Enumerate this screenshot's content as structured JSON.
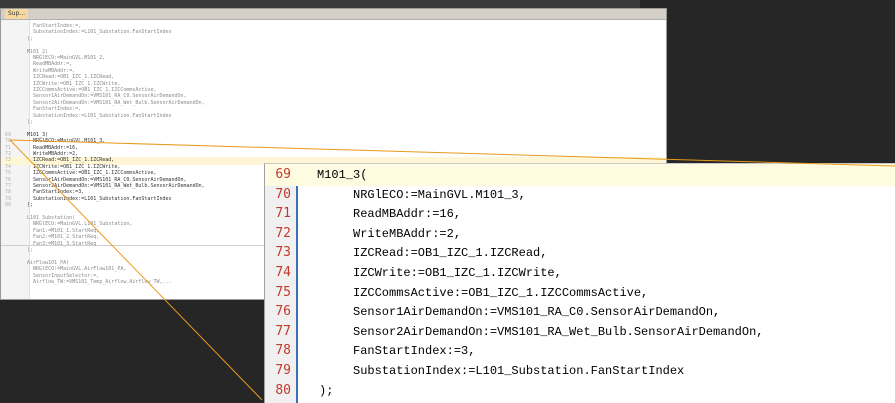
{
  "editor": {
    "tab_label": "Sup...",
    "small_lines": [
      {
        "n": "",
        "t": "    FanStartIndex:=,"
      },
      {
        "n": "",
        "t": "    SubstationIndex:=L101_Substation.FanStartIndex"
      },
      {
        "n": "",
        "t": "  );"
      },
      {
        "n": "",
        "t": ""
      },
      {
        "n": "",
        "t": "  M101_2("
      },
      {
        "n": "",
        "t": "    NRGlECO:=MainGVL.M101_2,"
      },
      {
        "n": "",
        "t": "    ReadMBAddr:=,"
      },
      {
        "n": "",
        "t": "    WriteMBAddr:=,"
      },
      {
        "n": "",
        "t": "    IZCRead:=OB1_IZC_1.IZCRead,"
      },
      {
        "n": "",
        "t": "    IZCWrite:=OB1_IZC_1.IZCWrite,"
      },
      {
        "n": "",
        "t": "    IZCCommsActive:=OB1_IZC_1.IZCCommsActive,"
      },
      {
        "n": "",
        "t": "    Sensor1AirDemandOn:=VMS101_RA_C0.SensorAirDemandOn,"
      },
      {
        "n": "",
        "t": "    Sensor2AirDemandOn:=VMS101_RA_Wet_Bulb.SensorAirDemandOn,"
      },
      {
        "n": "",
        "t": "    FanStartIndex:=,"
      },
      {
        "n": "",
        "t": "    SubstationIndex:=L101_Substation.FanStartIndex"
      },
      {
        "n": "",
        "t": "  );"
      },
      {
        "n": "",
        "t": ""
      },
      {
        "n": "69",
        "t": "  M101_3("
      },
      {
        "n": "70",
        "t": "    NRGlECO:=MainGVL.M101_3,"
      },
      {
        "n": "71",
        "t": "    ReadMBAddr:=16,"
      },
      {
        "n": "72",
        "t": "    WriteMBAddr:=2,"
      },
      {
        "n": "73",
        "t": "    IZCRead:=OB1_IZC_1.IZCRead,"
      },
      {
        "n": "74",
        "t": "    IZCWrite:=OB1_IZC_1.IZCWrite,"
      },
      {
        "n": "75",
        "t": "    IZCCommsActive:=OB1_IZC_1.IZCCommsActive,"
      },
      {
        "n": "76",
        "t": "    Sensor1AirDemandOn:=VMS101_RA_C0.SensorAirDemandOn,"
      },
      {
        "n": "77",
        "t": "    Sensor2AirDemandOn:=VMS101_RA_Wet_Bulb.SensorAirDemandOn,"
      },
      {
        "n": "78",
        "t": "    FanStartIndex:=3,"
      },
      {
        "n": "79",
        "t": "    SubstationIndex:=L101_Substation.FanStartIndex"
      },
      {
        "n": "80",
        "t": "  );"
      },
      {
        "n": "",
        "t": ""
      },
      {
        "n": "",
        "t": "  L101_Substation("
      },
      {
        "n": "",
        "t": "    NRGlECO:=MainGVL.L101_Substation,"
      },
      {
        "n": "",
        "t": "    Fan1:=M101_1.StartReq,"
      },
      {
        "n": "",
        "t": "    Fan2:=M101_2.StartReq,"
      },
      {
        "n": "",
        "t": "    Fan3:=M101_3.StartReq"
      },
      {
        "n": "",
        "t": "  );"
      },
      {
        "n": "",
        "t": ""
      },
      {
        "n": "",
        "t": "  AirFlow101_PA("
      },
      {
        "n": "",
        "t": "    NRGlECO:=MainGVL.AirFlow101_PA,"
      },
      {
        "n": "",
        "t": "    SensorInputSelector:=,"
      },
      {
        "n": "",
        "t": "    Airflow_TW:=VMS101_Temp_Airflow.Airflow_TW,..."
      }
    ]
  },
  "zoom": {
    "lines": [
      {
        "num": "69",
        "code": "M101_3("
      },
      {
        "num": "70",
        "code": "NRGlECO:=MainGVL.M101_3,"
      },
      {
        "num": "71",
        "code": "ReadMBAddr:=16,"
      },
      {
        "num": "72",
        "code": "WriteMBAddr:=2,"
      },
      {
        "num": "73",
        "code": "IZCRead:=OB1_IZC_1.IZCRead,"
      },
      {
        "num": "74",
        "code": "IZCWrite:=OB1_IZC_1.IZCWrite,"
      },
      {
        "num": "75",
        "code": "IZCCommsActive:=OB1_IZC_1.IZCCommsActive,"
      },
      {
        "num": "76",
        "code": "Sensor1AirDemandOn:=VMS101_RA_C0.SensorAirDemandOn,"
      },
      {
        "num": "77",
        "code": "Sensor2AirDemandOn:=VMS101_RA_Wet_Bulb.SensorAirDemandOn,"
      },
      {
        "num": "78",
        "code": "FanStartIndex:=3,"
      },
      {
        "num": "79",
        "code": "SubstationIndex:=L101_Substation.FanStartIndex"
      },
      {
        "num": "80",
        "code": ");"
      }
    ]
  },
  "colors": {
    "accent_orange": "#e89a1c",
    "line_number": "#c0392b",
    "gutter_bar": "#3b6fb6"
  }
}
